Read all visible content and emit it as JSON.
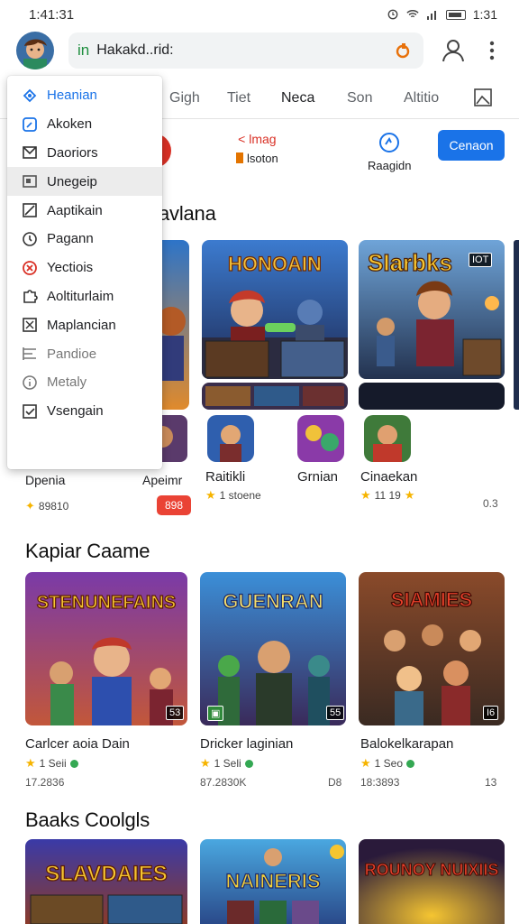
{
  "status": {
    "time": "1:41:31",
    "clock": "1:31"
  },
  "address": {
    "url": "Hakakd..rid:",
    "lock": "in"
  },
  "tabs": [
    "Gigh",
    "Tiet",
    "Neca",
    "Son",
    "Altitio"
  ],
  "quick": {
    "left_top": "< lmag",
    "left_bottom": "lsoton",
    "right_bottom": "Raagidn",
    "button": "Cenaon"
  },
  "dropdown": {
    "items": [
      {
        "label": "Heanian",
        "icon": "compass-icon"
      },
      {
        "label": "Akoken",
        "icon": "square-icon"
      },
      {
        "label": "Daoriors",
        "icon": "mail-icon"
      },
      {
        "label": "Unegeip",
        "icon": "tag-icon"
      },
      {
        "label": "Aaptikain",
        "icon": "edit-icon"
      },
      {
        "label": "Pagann",
        "icon": "clock-icon"
      },
      {
        "label": "Yectiois",
        "icon": "close-circle-icon"
      },
      {
        "label": "Aoltiturlaim",
        "icon": "puzzle-icon"
      },
      {
        "label": "Maplancian",
        "icon": "box-icon"
      },
      {
        "label": "Pandioe",
        "icon": "list-icon"
      },
      {
        "label": "Metaly",
        "icon": "info-icon"
      },
      {
        "label": "Vsengain",
        "icon": "check-box-icon"
      }
    ]
  },
  "section1": {
    "title": "avlana",
    "cards": [
      {
        "title": "SIarbks",
        "badge": "IOT"
      },
      {
        "title": "HONOAIN"
      }
    ],
    "apps": [
      {
        "name": "Dpenia",
        "meta": "89810"
      },
      {
        "name": "Apeimr",
        "price": "898"
      },
      {
        "name": "Raitikli",
        "meta": "1 stoene"
      },
      {
        "name": "Grnian"
      },
      {
        "name": "Cinaekan",
        "meta": "11 19"
      },
      {
        "name": "",
        "meta": "0.3"
      }
    ]
  },
  "section2": {
    "title": "Kapiar Caame",
    "games": [
      {
        "art": "STENUNEFAINS",
        "name": "Carlcer aoia Dain",
        "rating": "1 Seii",
        "meta": "17.2836",
        "badge": "53"
      },
      {
        "art": "GUENRAN",
        "name": "Dricker laginian",
        "rating": "1 Seli",
        "meta": "87.2830K",
        "meta2": "D8",
        "badge": "55"
      },
      {
        "art": "SIAMIES",
        "name": "Balokelkarapan",
        "rating": "1 Seo",
        "meta": "18:3893",
        "meta2": "13",
        "badge": "I6"
      }
    ]
  },
  "section3": {
    "title": "Baaks Coolgls",
    "games": [
      {
        "art": "SLAVDAIES"
      },
      {
        "art": "NAINERIS"
      },
      {
        "art": "ROUNOY NUIXIIS"
      }
    ]
  }
}
